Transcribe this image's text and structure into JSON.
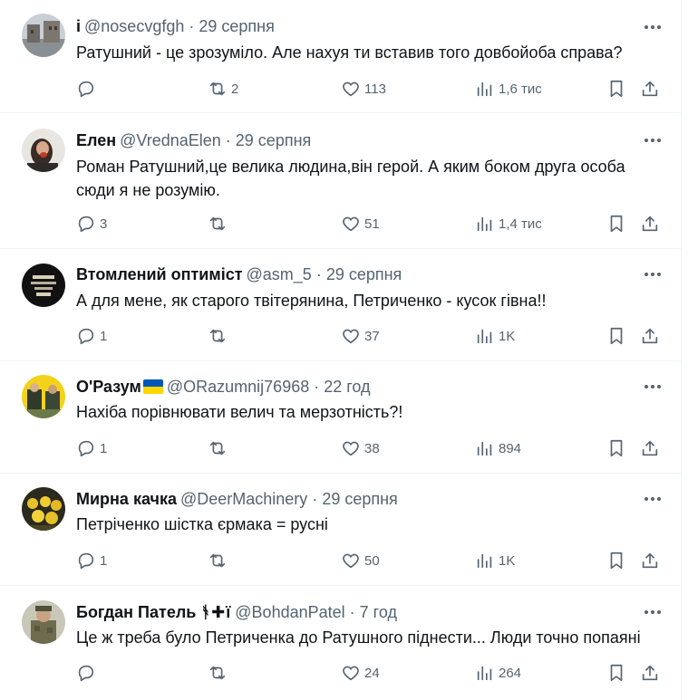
{
  "tweets": [
    {
      "name": "і",
      "handle": "@nosecvgfgh",
      "time": "29 серпня",
      "text": "Ратушний - це зрозуміло. Але нахуя ти вставив того довбойоба справа?",
      "replies": "",
      "retweets": "2",
      "likes": "113",
      "views": "1,6 тис"
    },
    {
      "name": "Елен",
      "handle": "@VrednaElen",
      "time": "29 серпня",
      "text": "Роман Ратушний,це велика людина,він герой. А яким боком друга особа сюди я не розумію.",
      "replies": "3",
      "retweets": "",
      "likes": "51",
      "views": "1,4 тис"
    },
    {
      "name": "Втомлений оптиміст",
      "handle": "@asm_5",
      "time": "29 серпня",
      "text": "А для мене, як старого твітерянина, Петриченко - кусок гівна!!",
      "replies": "1",
      "retweets": "",
      "likes": "37",
      "views": "1K"
    },
    {
      "name": "О'Разум",
      "handle": "@ORazumnij76968",
      "time": "22 год",
      "text": "Нахіба порівнювати велич та мерзотність?!",
      "replies": "1",
      "retweets": "",
      "likes": "38",
      "views": "894"
    },
    {
      "name": "Мирна качка",
      "handle": "@DeerMachinery",
      "time": "29 серпня",
      "text": "Петріченко шістка єрмака = русні",
      "replies": "1",
      "retweets": "",
      "likes": "50",
      "views": "1K"
    },
    {
      "name": "Богдан Патель",
      "name_symbols": "ᚬ✚ї",
      "handle": "@BohdanPatel",
      "time": "7 год",
      "text": "Це ж треба було Петриченка до Ратушного піднести... Люди точно попаяні",
      "replies": "",
      "retweets": "",
      "likes": "24",
      "views": "264"
    }
  ],
  "separator": "·",
  "colors": {
    "text": "#0f1419",
    "secondary": "#536471",
    "border": "#eff3f4",
    "flag_blue": "#0057b7",
    "flag_yellow": "#ffd700"
  },
  "icons": [
    "reply-icon",
    "retweet-icon",
    "like-icon",
    "views-icon",
    "bookmark-icon",
    "share-icon",
    "more-icon"
  ]
}
